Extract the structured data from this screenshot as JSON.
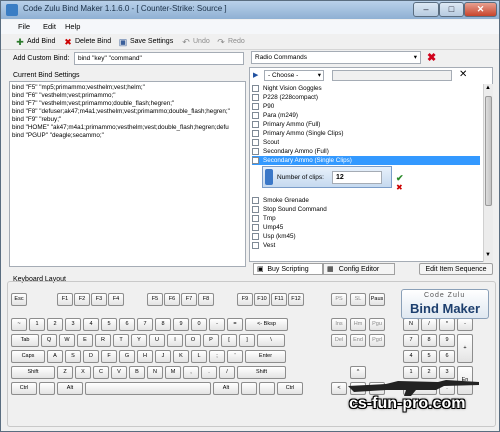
{
  "window": {
    "title": "Code Zulu Bind Maker 1.1.6.0 - [ Counter-Strike: Source ]",
    "min": "–",
    "max": "□",
    "close": "✕"
  },
  "menu": [
    "File",
    "Edit",
    "Help"
  ],
  "toolbar": {
    "add": "Add Bind",
    "delete": "Delete Bind",
    "save": "Save Settings",
    "undo": "Undo",
    "redo": "Redo"
  },
  "custom_bind": {
    "label": "Add Custom Bind:",
    "value": "bind \"key\" \"command\""
  },
  "current": {
    "title": "Current Bind Settings",
    "lines": [
      "bind \"F5\" \"mp5;primammo;vesthelm;vest;helm;\"",
      "bind \"F6\" \"vesthelm;vest;primammo;\"",
      "bind \"F7\" \"vesthelm;vest;primammo;double_flash;hegren;\"",
      "bind \"F8\" \"defuser;ak47;m4a1;vesthelm;vest;primammo;double_flash;hegren;\"",
      "bind \"F9\" \"rebuy;\"",
      "bind \"HOME\" \"ak47;m4a1;primammo;vesthelm;vest;double_flash;hegren;defu",
      "bind \"PGUP\" \"deagle;secammo;\""
    ]
  },
  "commands": {
    "category": "Radio Commands",
    "choose": "- Choose -",
    "items": [
      "Night Vision Goggles",
      "P228 (228compact)",
      "P90",
      "Para (m249)",
      "Primary Ammo (Full)",
      "Primary Ammo (Single Clips)",
      "Scout",
      "Secondary Ammo (Full)",
      "Secondary Ammo (Single Clips)"
    ],
    "items2": [
      "Smoke Grenade",
      "Stop Sound Command",
      "Tmp",
      "Ump45",
      "Usp (km45)",
      "Vest"
    ],
    "selected": "Secondary Ammo (Single Clips)",
    "clips_label": "Number of clips:",
    "clips_value": "12"
  },
  "tabs": {
    "buy": "Buy Scripting",
    "config": "Config Editor",
    "edit_seq": "Edit Item Sequence"
  },
  "keyboard": {
    "title": "Keyboard Layout",
    "fn": [
      "Esc",
      "F1",
      "F2",
      "F3",
      "F4",
      "F5",
      "F6",
      "F7",
      "F8",
      "F9",
      "F10",
      "F11",
      "F12",
      "PS",
      "SL",
      "Paus"
    ],
    "row1": [
      "~",
      "1",
      "2",
      "3",
      "4",
      "5",
      "6",
      "7",
      "8",
      "9",
      "0",
      "-",
      "=",
      "<- Bksp"
    ],
    "row2": [
      "Tab",
      "Q",
      "W",
      "E",
      "R",
      "T",
      "Y",
      "U",
      "I",
      "O",
      "P",
      "[",
      "]",
      "\\"
    ],
    "row3": [
      "Caps",
      "A",
      "S",
      "D",
      "F",
      "G",
      "H",
      "J",
      "K",
      "L",
      ";",
      "'",
      "Enter"
    ],
    "row4": [
      "Shift",
      "Z",
      "X",
      "C",
      "V",
      "B",
      "N",
      "M",
      ",",
      ".",
      "/",
      "Shift"
    ],
    "row5": [
      "Ctrl",
      "Alt",
      "Alt",
      "Ctrl"
    ],
    "nav": [
      "Ins",
      "Hm",
      "Pgu",
      "Del",
      "End",
      "Pgd"
    ],
    "arrows": [
      "^",
      "<",
      "v",
      ">"
    ],
    "num": [
      "N",
      "/",
      "*",
      "-",
      "7",
      "8",
      "9",
      "+",
      "4",
      "5",
      "6",
      "1",
      "2",
      "3",
      "En",
      "0",
      "."
    ]
  },
  "logo": {
    "line1": "Code Zulu",
    "line2": "Bind Maker"
  },
  "watermark": "cs-fun-pro.com"
}
